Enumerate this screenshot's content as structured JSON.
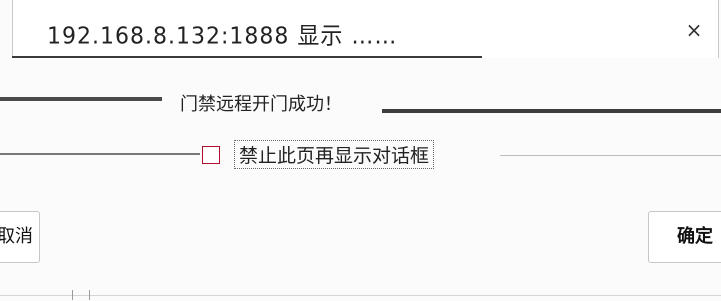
{
  "dialog": {
    "title": "192.168.8.132:1888 显示 ……",
    "message": "门禁远程开门成功！",
    "checkbox_label": "禁止此页再显示对话框",
    "buttons": {
      "cancel_label": "取消",
      "ok_label": "确定"
    },
    "close_symbol": "×"
  },
  "colors": {
    "checkbox_border": "#b10f2e",
    "button_border": "#c7c7c7"
  },
  "icons": {
    "close": "close-icon"
  }
}
